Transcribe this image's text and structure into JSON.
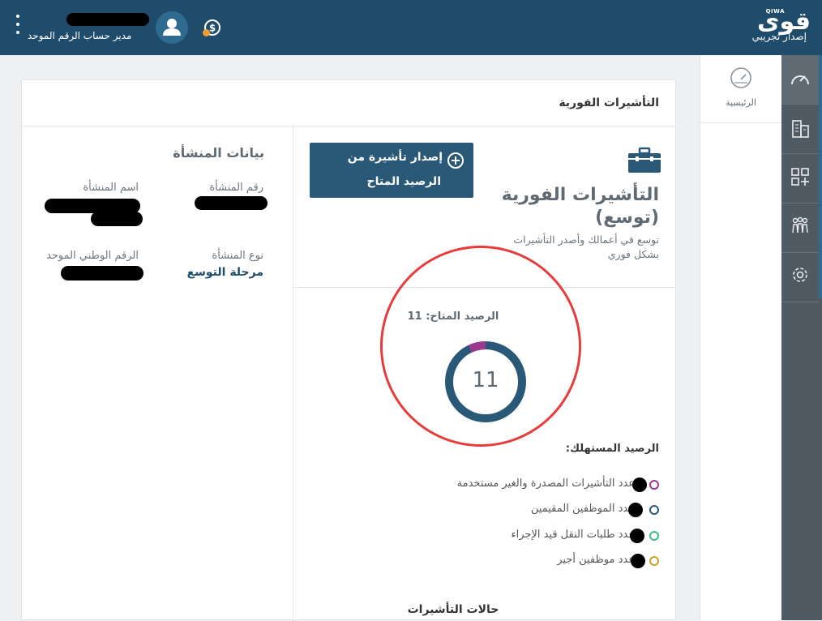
{
  "header": {
    "logo_text": "قوى",
    "logo_brand": "QIWA",
    "version_label": "إصدار تجريبي",
    "user_role": "مدير حساب الرقم الموحد",
    "colors": {
      "bar": "#1f4c6b",
      "avatar": "#2f6a91",
      "coin_badge": "#f0a030"
    }
  },
  "rail": {
    "items": [
      {
        "icon": "speedometer-icon"
      },
      {
        "icon": "buildings-icon"
      },
      {
        "icon": "add-apps-icon"
      },
      {
        "icon": "people-icon"
      },
      {
        "icon": "gear-icon"
      }
    ]
  },
  "sidebar": {
    "home_label": "الرئيسية"
  },
  "page": {
    "title": "التأشيرات الفورية"
  },
  "establishment": {
    "title": "بيانات المنشأة",
    "number_label": "رقم المنشأة",
    "name_label": "اسم المنشأة",
    "type_label": "نوع المنشأة",
    "type_value": "مرحلة التوسع",
    "unified_label": "الرقم الوطني الموحد"
  },
  "service": {
    "issue_button_line1": "إصدار تأشيرة من",
    "issue_button_line2": "الرصيد المتاح",
    "title_line1": "التأشيرات الفورية",
    "title_line2": "(توسع)",
    "desc_line1": "توسع في أعمالك وأصدر التأشيرات",
    "desc_line2": "بشكل فوري"
  },
  "balance": {
    "label": "الرصيد المتاح: 11",
    "value": "11",
    "ring_colors": {
      "main": "#2a5877",
      "used": "#9b3a8c"
    },
    "used_fraction": 0.07
  },
  "consumed": {
    "title": "الرصيد المستهلك:",
    "items": [
      {
        "text": "عدد التأشيرات المصدرة والغير مستخدمة",
        "color": "#9b3a8c"
      },
      {
        "text": "عدد الموظفين المقيمين",
        "color": "#2a5877"
      },
      {
        "text": "عدد طلبات النقل قيد الإجراء",
        "color": "#3bbf8a"
      },
      {
        "text": "عدد موظفين أجير",
        "color": "#c9a227"
      }
    ]
  },
  "visa_status": {
    "title": "حالات التأشيرات"
  }
}
